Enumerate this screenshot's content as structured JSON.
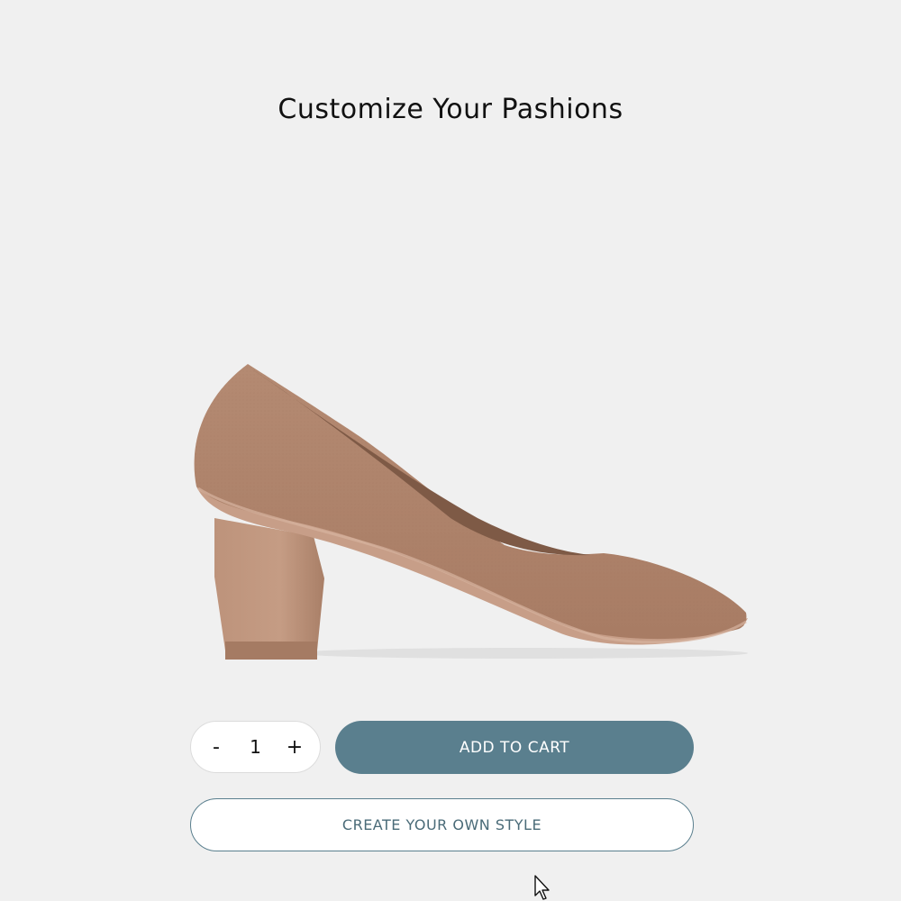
{
  "page": {
    "title": "Customize Your Pashions"
  },
  "product": {
    "image_icon": "high-heel-pump-shoe",
    "color": "#b0826a"
  },
  "quantity": {
    "decrement_label": "-",
    "value": "1",
    "increment_label": "+"
  },
  "actions": {
    "add_to_cart_label": "ADD TO CART",
    "create_style_label": "CREATE YOUR OWN STYLE"
  },
  "colors": {
    "background": "#f0f0f0",
    "accent": "#5a7f8e"
  }
}
